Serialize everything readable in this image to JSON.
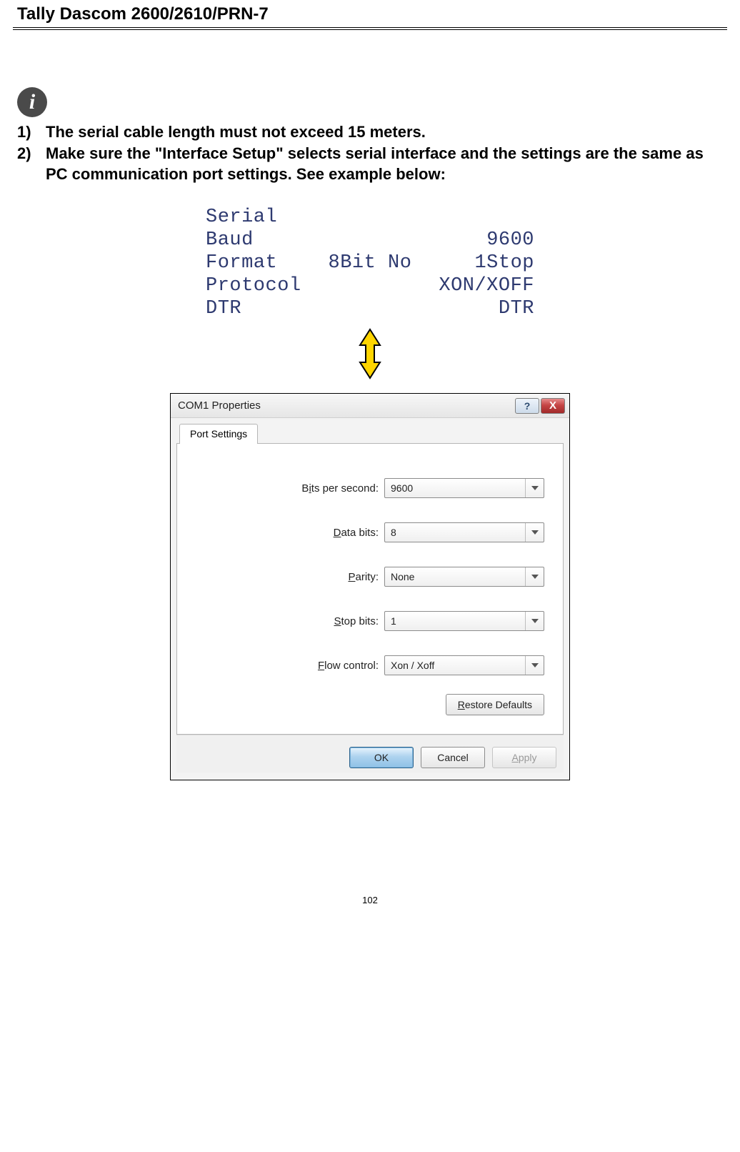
{
  "header": {
    "title": "Tally Dascom 2600/2610/PRN-7"
  },
  "info_icon_glyph": "i",
  "notes": {
    "items": [
      {
        "num": "1)",
        "text": "The serial cable length must not exceed 15 meters."
      },
      {
        "num": "2)",
        "text": "Make sure the \"Interface Setup\" selects serial interface and the settings are the same as PC communication port settings. See example below:"
      }
    ]
  },
  "printout": {
    "rows": [
      {
        "label": "Serial",
        "mid": "",
        "value": ""
      },
      {
        "label": "Baud",
        "mid": "",
        "value": "9600"
      },
      {
        "label": "Format",
        "mid": "8Bit No",
        "value": "1Stop"
      },
      {
        "label": "Protocol",
        "mid": "",
        "value": "XON/XOFF"
      },
      {
        "label": "DTR",
        "mid": "",
        "value": "DTR"
      }
    ]
  },
  "dialog": {
    "title": "COM1 Properties",
    "help_glyph": "?",
    "close_glyph": "X",
    "tab_label": "Port Settings",
    "fields": {
      "bits_per_second": {
        "label_pre": "B",
        "label_und": "i",
        "label_post": "ts per second:",
        "value": "9600"
      },
      "data_bits": {
        "label_pre": "",
        "label_und": "D",
        "label_post": "ata bits:",
        "value": "8"
      },
      "parity": {
        "label_pre": "",
        "label_und": "P",
        "label_post": "arity:",
        "value": "None"
      },
      "stop_bits": {
        "label_pre": "",
        "label_und": "S",
        "label_post": "top bits:",
        "value": "1"
      },
      "flow_control": {
        "label_pre": "",
        "label_und": "F",
        "label_post": "low control:",
        "value": "Xon / Xoff"
      }
    },
    "buttons": {
      "restore_pre": "",
      "restore_und": "R",
      "restore_post": "estore Defaults",
      "ok": "OK",
      "cancel": "Cancel",
      "apply_pre": "",
      "apply_und": "A",
      "apply_post": "pply"
    }
  },
  "page_number": "102"
}
